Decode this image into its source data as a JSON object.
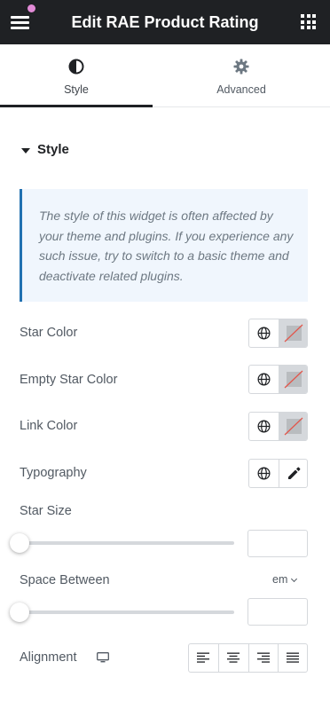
{
  "header": {
    "title": "Edit RAE Product Rating",
    "menu_icon": "hamburger-menu-icon",
    "apps_icon": "grid-apps-icon",
    "notification_color": "#e28bd7"
  },
  "tabs": [
    {
      "label": "Style",
      "icon": "contrast-half-circle-icon",
      "active": true
    },
    {
      "label": "Advanced",
      "icon": "gear-icon",
      "active": false
    }
  ],
  "section": {
    "title": "Style",
    "notice": "The style of this widget is often affected by your theme and plugins. If you experience any such issue, try to switch to a basic theme and deactivate related plugins."
  },
  "controls": {
    "star_color": {
      "label": "Star Color"
    },
    "empty_star_color": {
      "label": "Empty Star Color"
    },
    "link_color": {
      "label": "Link Color"
    },
    "typography": {
      "label": "Typography"
    },
    "star_size": {
      "label": "Star Size",
      "value": "",
      "slider_value": 0
    },
    "space_between": {
      "label": "Space Between",
      "unit": "em",
      "value": "",
      "slider_value": 0
    },
    "alignment": {
      "label": "Alignment",
      "options": [
        "align-left-icon",
        "align-center-icon",
        "align-right-icon",
        "align-justify-icon"
      ]
    }
  },
  "colors": {
    "header_bg": "#1f2124",
    "notice_bg": "#f0f6fd",
    "notice_border": "#2271b1",
    "no_color_slash": "#e2574c"
  }
}
